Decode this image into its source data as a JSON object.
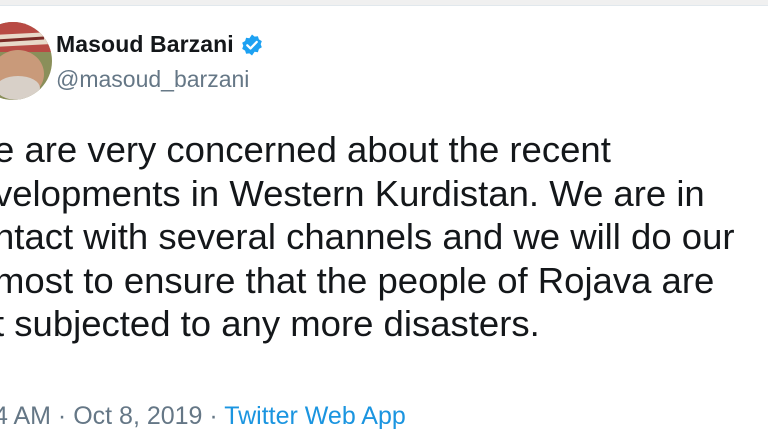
{
  "author": {
    "display_name": "Masoud Barzani",
    "handle": "@masoud_barzani",
    "verified_icon": "verified-badge-icon",
    "avatar_icon": "profile-photo"
  },
  "tweet": {
    "text": "e are very concerned about the recent\nvelopments in Western Kurdistan. We are in\nntact with several channels and we will do our\nmost to ensure that the people of Rojava are\nt subjected to any more disasters."
  },
  "meta": {
    "time": "4 AM",
    "separator_1": " · ",
    "date": "Oct 8, 2019",
    "separator_2": " · ",
    "source": "Twitter Web App"
  },
  "colors": {
    "text": "#14171a",
    "secondary": "#657786",
    "link": "#1b95e0",
    "verified": "#1da1f2"
  }
}
